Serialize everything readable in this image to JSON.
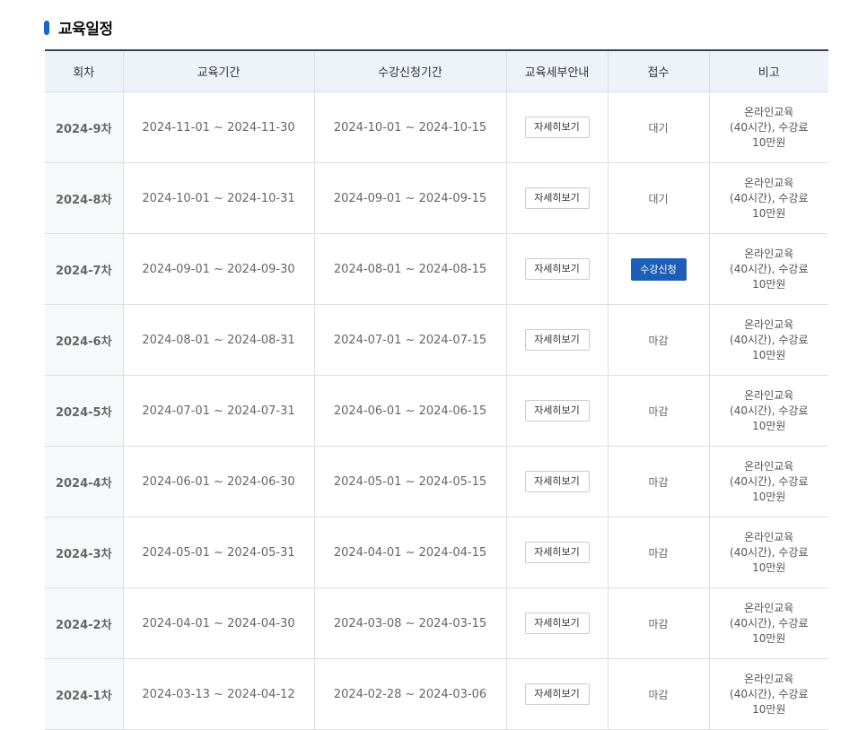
{
  "section": {
    "title": "교육일정"
  },
  "table": {
    "headers": [
      "회차",
      "교육기간",
      "수강신청기간",
      "교육세부안내",
      "접수",
      "비고"
    ],
    "detail_label": "자세히보기",
    "rows": [
      {
        "round": "2024-9차",
        "edu_period": "2024-11-01 ~ 2024-11-30",
        "apply_period": "2024-10-01 ~ 2024-10-15",
        "status": "대기",
        "status_type": "text",
        "note": "온라인교육\n(40시간), 수강료\n10만원"
      },
      {
        "round": "2024-8차",
        "edu_period": "2024-10-01 ~ 2024-10-31",
        "apply_period": "2024-09-01 ~ 2024-09-15",
        "status": "대기",
        "status_type": "text",
        "note": "온라인교육\n(40시간), 수강료\n10만원"
      },
      {
        "round": "2024-7차",
        "edu_period": "2024-09-01 ~ 2024-09-30",
        "apply_period": "2024-08-01 ~ 2024-08-15",
        "status": "수강신청",
        "status_type": "button",
        "note": "온라인교육\n(40시간), 수강료\n10만원"
      },
      {
        "round": "2024-6차",
        "edu_period": "2024-08-01 ~ 2024-08-31",
        "apply_period": "2024-07-01 ~ 2024-07-15",
        "status": "마감",
        "status_type": "text",
        "note": "온라인교육\n(40시간), 수강료\n10만원"
      },
      {
        "round": "2024-5차",
        "edu_period": "2024-07-01 ~ 2024-07-31",
        "apply_period": "2024-06-01 ~ 2024-06-15",
        "status": "마감",
        "status_type": "text",
        "note": "온라인교육\n(40시간), 수강료\n10만원"
      },
      {
        "round": "2024-4차",
        "edu_period": "2024-06-01 ~ 2024-06-30",
        "apply_period": "2024-05-01 ~ 2024-05-15",
        "status": "마감",
        "status_type": "text",
        "note": "온라인교육\n(40시간), 수강료\n10만원"
      },
      {
        "round": "2024-3차",
        "edu_period": "2024-05-01 ~ 2024-05-31",
        "apply_period": "2024-04-01 ~ 2024-04-15",
        "status": "마감",
        "status_type": "text",
        "note": "온라인교육\n(40시간), 수강료\n10만원"
      },
      {
        "round": "2024-2차",
        "edu_period": "2024-04-01 ~ 2024-04-30",
        "apply_period": "2024-03-08 ~ 2024-03-15",
        "status": "마감",
        "status_type": "text",
        "note": "온라인교육\n(40시간), 수강료\n10만원"
      },
      {
        "round": "2024-1차",
        "edu_period": "2024-03-13 ~ 2024-04-12",
        "apply_period": "2024-02-28 ~ 2024-03-06",
        "status": "마감",
        "status_type": "text",
        "note": "온라인교육\n(40시간), 수강료\n10만원"
      }
    ]
  },
  "colors": {
    "accent": "#1668c8",
    "apply_button": "#1d5fb8",
    "header_bg": "#eef3fa"
  }
}
